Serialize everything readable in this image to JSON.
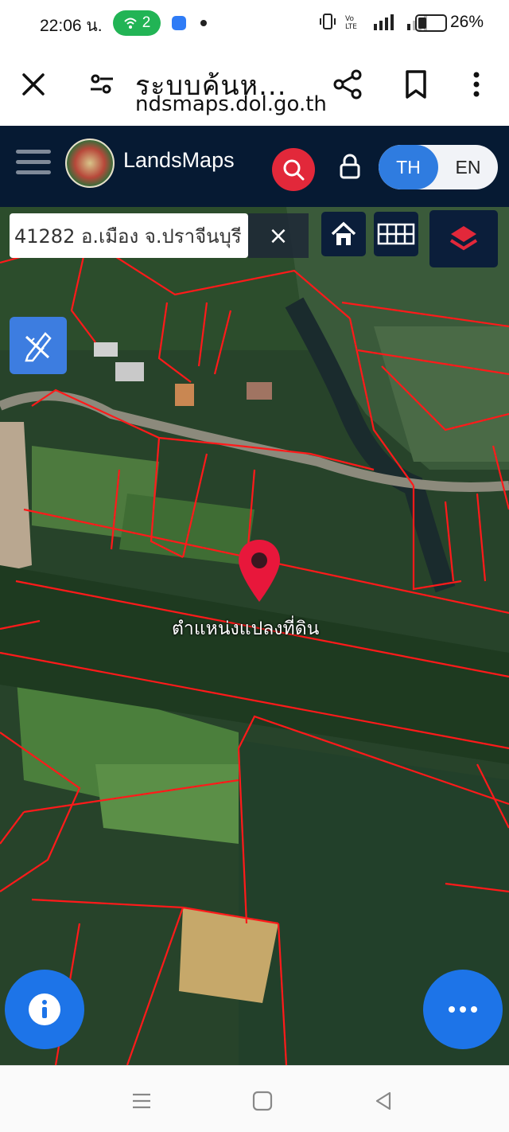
{
  "status_bar": {
    "time": "22:06 น.",
    "hotspot_count": "2",
    "battery_percent": "26%"
  },
  "browser": {
    "title": "ระบบค้นห...",
    "url": "ndsmaps.dol.go.th"
  },
  "app": {
    "brand": "LandsMaps",
    "lang_th": "TH",
    "lang_en": "EN",
    "active_lang": "TH"
  },
  "map": {
    "search_value": "41282 อ.เมือง จ.ปราจีนบุรี",
    "clear_symbol": "×",
    "pin_label": "ตำแหน่งแปลงที่ดิน"
  },
  "icons": [
    "close-icon",
    "tune-icon",
    "share-icon",
    "bookmark-icon",
    "more-vert-icon",
    "menu-icon",
    "search-icon",
    "lock-icon",
    "home-icon",
    "grid-icon",
    "layers-icon",
    "measure-icon",
    "location-pin-icon",
    "info-icon",
    "more-horiz-icon",
    "nav-recent-icon",
    "nav-home-icon",
    "nav-back-icon"
  ],
  "colors": {
    "header_bg": "#061a33",
    "accent_blue": "#2f7ce0",
    "search_red": "#e2283a",
    "parcel_red": "#ff1a1a"
  }
}
